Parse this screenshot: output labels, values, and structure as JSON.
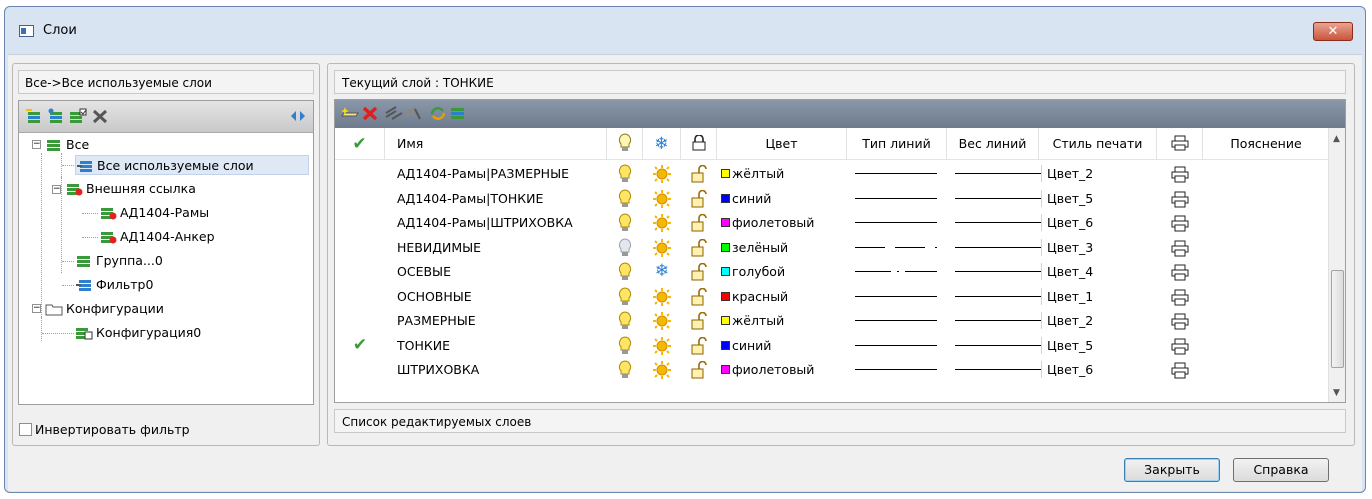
{
  "window": {
    "title": "Слои",
    "close_glyph": "✕"
  },
  "left_panel": {
    "filter_path": "Все->Все используемые слои",
    "toolbar": [
      "new-property-filter-icon",
      "new-group-filter-icon",
      "layer-states-icon",
      "delete-icon",
      "collapse-icon"
    ],
    "tree": {
      "all": "Все",
      "all_used": "Все используемые слои",
      "xref": "Внешняя ссылка",
      "xref_1": "АД1404-Рамы",
      "xref_2": "АД1404-Анкер",
      "group": "Группа...0",
      "filter": "Фильтр0",
      "configurations": "Конфигурации",
      "configuration0": "Конфигурация0"
    },
    "invert_filter_label": "Инвертировать фильтр"
  },
  "right_panel": {
    "current_layer": "Текущий слой : ТОНКИЕ",
    "columns": {
      "status": "✔",
      "name": "Имя",
      "color": "Цвет",
      "linetype": "Тип линий",
      "lineweight": "Вес линий",
      "plotstyle": "Стиль печати",
      "description": "Пояснение"
    },
    "layers": [
      {
        "name": "АД1404-Рамы|РАЗМЕРНЫЕ",
        "on": true,
        "frozen": false,
        "color_name": "жёлтый",
        "color": "#ffff00",
        "linetype": "solid",
        "plotstyle": "Цвет_2",
        "current": false
      },
      {
        "name": "АД1404-Рамы|ТОНКИЕ",
        "on": true,
        "frozen": false,
        "color_name": "синий",
        "color": "#0000ff",
        "linetype": "solid",
        "plotstyle": "Цвет_5",
        "current": false
      },
      {
        "name": "АД1404-Рамы|ШТРИХОВКА",
        "on": true,
        "frozen": false,
        "color_name": "фиолетовый",
        "color": "#ff00ff",
        "linetype": "solid",
        "plotstyle": "Цвет_6",
        "current": false
      },
      {
        "name": "НЕВИДИМЫЕ",
        "on": false,
        "frozen": false,
        "color_name": "зелёный",
        "color": "#00ff00",
        "linetype": "dashed",
        "plotstyle": "Цвет_3",
        "current": false
      },
      {
        "name": "ОСЕВЫЕ",
        "on": true,
        "frozen": true,
        "color_name": "голубой",
        "color": "#00ffff",
        "linetype": "center",
        "plotstyle": "Цвет_4",
        "current": false
      },
      {
        "name": "ОСНОВНЫЕ",
        "on": true,
        "frozen": false,
        "color_name": "красный",
        "color": "#ff0000",
        "linetype": "solid",
        "plotstyle": "Цвет_1",
        "current": false
      },
      {
        "name": "РАЗМЕРНЫЕ",
        "on": true,
        "frozen": false,
        "color_name": "жёлтый",
        "color": "#ffff00",
        "linetype": "solid",
        "plotstyle": "Цвет_2",
        "current": false
      },
      {
        "name": "ТОНКИЕ",
        "on": true,
        "frozen": false,
        "color_name": "синий",
        "color": "#0000ff",
        "linetype": "solid",
        "plotstyle": "Цвет_5",
        "current": true
      },
      {
        "name": "ШТРИХОВКА",
        "on": true,
        "frozen": false,
        "color_name": "фиолетовый",
        "color": "#ff00ff",
        "linetype": "solid",
        "plotstyle": "Цвет_6",
        "current": false
      }
    ],
    "status_text": "Список редактируемых слоев"
  },
  "buttons": {
    "close": "Закрыть",
    "help": "Справка"
  }
}
